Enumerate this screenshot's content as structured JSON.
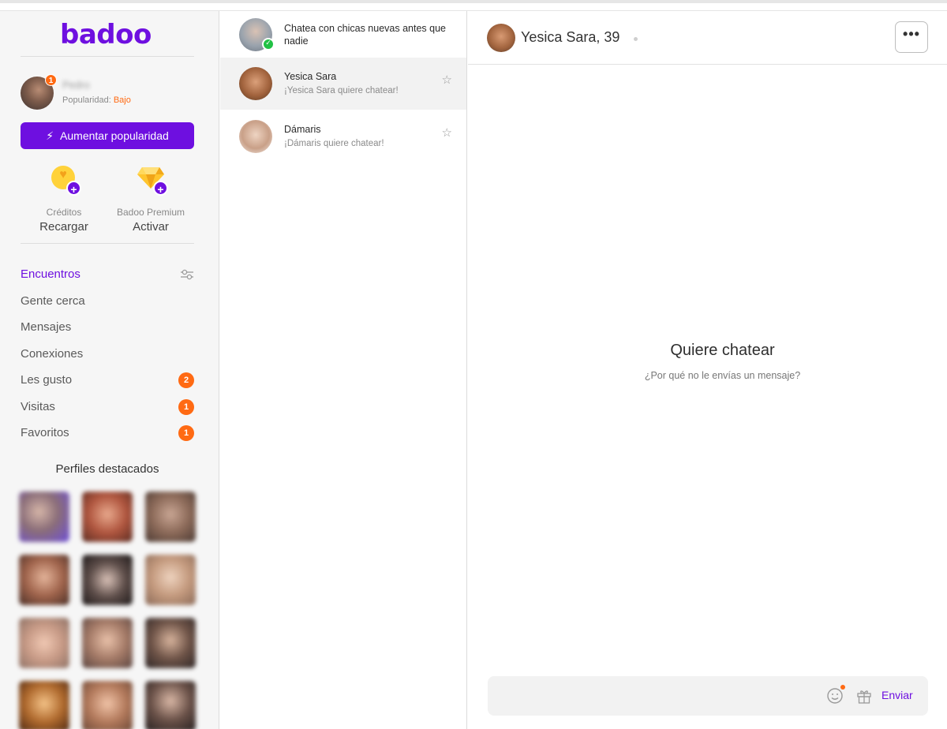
{
  "brand": {
    "logo": "badoo",
    "accent": "#6e0fe0",
    "badge_color": "#ff6a13",
    "online_color": "#21c145"
  },
  "user": {
    "name": "Pedro",
    "notification_count": "1",
    "popularity_label": "Popularidad:",
    "popularity_value": "Bajo"
  },
  "boost_button": {
    "label": "Aumentar popularidad",
    "icon": "bolt-icon"
  },
  "promos": [
    {
      "caption": "Créditos",
      "action": "Recargar",
      "icon": "coin-heart-icon"
    },
    {
      "caption": "Badoo Premium",
      "action": "Activar",
      "icon": "diamond-icon"
    }
  ],
  "nav": [
    {
      "label": "Encuentros",
      "active": true,
      "icon": "filter-sliders-icon"
    },
    {
      "label": "Gente cerca"
    },
    {
      "label": "Mensajes"
    },
    {
      "label": "Conexiones"
    },
    {
      "label": "Les gusto",
      "badge": "2"
    },
    {
      "label": "Visitas",
      "badge": "1"
    },
    {
      "label": "Favoritos",
      "badge": "1"
    }
  ],
  "featured": {
    "title": "Perfiles destacados",
    "count": 12
  },
  "conversations": {
    "promo": {
      "text": "Chatea con chicas nuevas antes que nadie"
    },
    "items": [
      {
        "name": "Yesica Sara",
        "preview": "¡Yesica Sara quiere chatear!",
        "selected": true
      },
      {
        "name": "Dámaris",
        "preview": "¡Dámaris quiere chatear!",
        "selected": false
      }
    ]
  },
  "chat": {
    "title": "Yesica Sara, 39",
    "more_label": "•••",
    "empty_title": "Quiere chatear",
    "empty_subtitle": "¿Por qué no le envías un mensaje?",
    "send_label": "Enviar"
  }
}
